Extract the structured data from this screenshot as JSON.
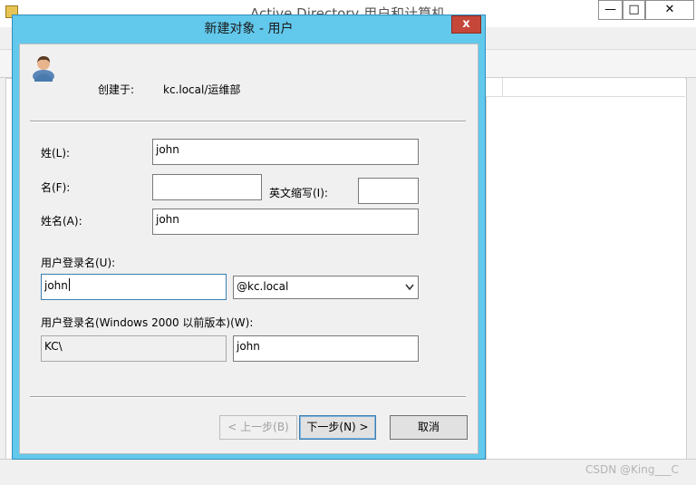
{
  "background_window": {
    "title": "Active Directory 用户和计算机",
    "controls": {
      "minimize": "—",
      "maximize": "□",
      "close": "✕"
    }
  },
  "watermark": "CSDN @King___C",
  "dialog": {
    "title": "新建对象 - 用户",
    "close_glyph": "x",
    "created_in_label": "创建于:",
    "created_in_value": "kc.local/运维部",
    "fields": {
      "last_name_label": "姓(L):",
      "last_name_value": "john",
      "first_name_label": "名(F):",
      "first_name_value": "",
      "initials_label": "英文缩写(I):",
      "initials_value": "",
      "full_name_label": "姓名(A):",
      "full_name_value": "john",
      "logon_name_label": "用户登录名(U):",
      "logon_name_value": "john",
      "domain_suffix_selected": "@kc.local",
      "pre2000_label": "用户登录名(Windows 2000 以前版本)(W):",
      "pre2000_domain_value": "KC\\",
      "pre2000_name_value": "john"
    },
    "buttons": {
      "back": "< 上一步(B)",
      "next": "下一步(N) >",
      "cancel": "取消"
    }
  },
  "colors": {
    "dialog_frame": "#62c8ec",
    "close_button": "#c5473a",
    "body": "#f0f0f0"
  },
  "icons": [
    "user-icon",
    "chevron-down-icon",
    "close-icon",
    "app-icon"
  ]
}
